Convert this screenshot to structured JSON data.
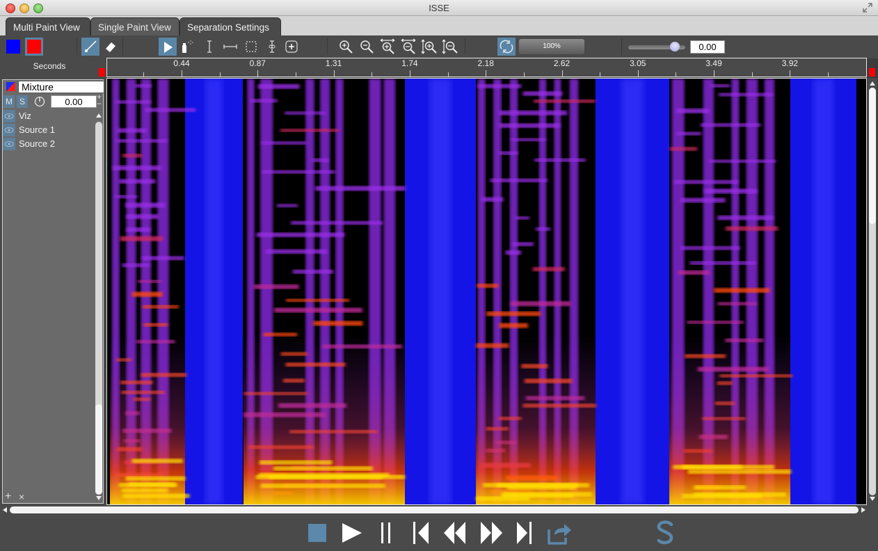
{
  "window": {
    "title": "ISSE"
  },
  "tabs": [
    {
      "label": "Multi Paint View",
      "active": false
    },
    {
      "label": "Single Paint View",
      "active": true
    },
    {
      "label": "Separation Settings",
      "active": false
    }
  ],
  "toolbar": {
    "colors": {
      "primary": "#0000ff",
      "secondary": "#ff0000"
    },
    "tools": [
      "color-blue",
      "color-red",
      "brush",
      "eraser",
      "select-pointer",
      "spray",
      "time-select",
      "frequency-select",
      "box-select",
      "harmonic-select",
      "add-select"
    ],
    "zoom_tools": [
      "zoom-in",
      "zoom-out",
      "zoom-in-horizontal",
      "zoom-out-horizontal",
      "zoom-in-vertical",
      "zoom-out-vertical"
    ],
    "loop_selected": true,
    "progress_label": "100%",
    "progress_value": 1.0,
    "gain_slider_value": 0.8,
    "gain_value": "0.00"
  },
  "ruler": {
    "axis_label": "Seconds",
    "ticks": [
      "0.44",
      "0.87",
      "1.31",
      "1.74",
      "2.18",
      "2.62",
      "3.05",
      "3.49",
      "3.92"
    ]
  },
  "layers": {
    "mixture_name": "Mixture",
    "mute_label": "M",
    "solo_label": "S",
    "volume_value": "0.00",
    "items": [
      {
        "label": "Viz"
      },
      {
        "label": "Source 1"
      },
      {
        "label": "Source 2"
      }
    ],
    "add_label": "+",
    "remove_label": "×"
  },
  "transport": {
    "buttons": [
      "stop",
      "play",
      "pause",
      "skip-to-start",
      "rewind",
      "fast-forward",
      "skip-to-end",
      "export"
    ]
  },
  "colors": {
    "accent": "#5b85a5",
    "panel": "#4a4a4a",
    "spectro_blue": "#1010e8",
    "spectro_purple": "#8a2be2",
    "spectro_orange": "#ff4500",
    "spectro_yellow": "#ffee00"
  }
}
